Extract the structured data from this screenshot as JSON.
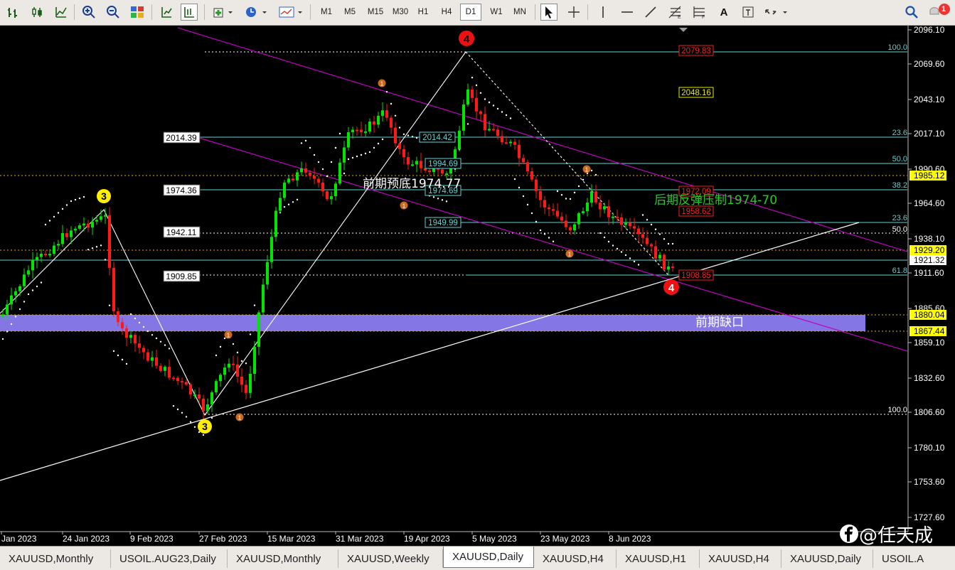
{
  "toolbar": {
    "timeframes": [
      "M1",
      "M5",
      "M15",
      "M30",
      "H1",
      "H4",
      "D1",
      "W1",
      "MN"
    ],
    "active_timeframe": "D1",
    "icons": [
      "bar-chart-icon",
      "candlestick-icon",
      "line-chart-icon",
      "zoom-in-icon",
      "zoom-out-icon",
      "tile-windows-icon",
      "chart-shift-icon",
      "autoscroll-icon",
      "indicators-icon",
      "periods-icon",
      "templates-icon",
      "cursor-icon",
      "crosshair-icon",
      "vertical-line-icon",
      "horizontal-line-icon",
      "trendline-icon",
      "fibonacci-icon",
      "fibonacci-fan-icon",
      "text-icon",
      "label-icon",
      "arrows-icon",
      "search-icon",
      "notifications-icon"
    ],
    "notification_count": "1"
  },
  "chart": {
    "symbol": "XAUUSD",
    "timeframe": "Daily",
    "price_axis_labels": [
      "2096.10",
      "2069.60",
      "2043.10",
      "2017.10",
      "1990.60",
      "1964.60",
      "1938.10",
      "1911.60",
      "1885.60",
      "1859.10",
      "1832.60",
      "1806.60",
      "1780.10",
      "1753.60",
      "1727.60"
    ],
    "highlighted_prices": [
      {
        "text": "1985.12",
        "bg": "#ffff00",
        "fg": "#000000"
      },
      {
        "text": "1929.20",
        "bg": "#ffff00",
        "fg": "#000000"
      },
      {
        "text": "1921.32",
        "bg": "#ffffff",
        "fg": "#000000"
      },
      {
        "text": "1880.04",
        "bg": "#ffff00",
        "fg": "#000000"
      },
      {
        "text": "1867.44",
        "bg": "#ffff00",
        "fg": "#000000"
      }
    ],
    "date_labels": [
      "Jan 2023",
      "24 Jan 2023",
      "9 Feb 2023",
      "27 Feb 2023",
      "15 Mar 2023",
      "31 Mar 2023",
      "19 Apr 2023",
      "5 May 2023",
      "23 May 2023",
      "8 Jun 2023"
    ],
    "level_boxes_white": [
      "2014.39",
      "1974.36",
      "1942.11",
      "1909.85"
    ],
    "level_boxes_cyan": [
      "2014.42",
      "1994.69",
      "1974.69",
      "1949.99"
    ],
    "level_boxes_red": [
      "2079.83",
      "1972.09",
      "1958.62",
      "1908.85"
    ],
    "level_box_yellow": "2048.16",
    "fib_right_labels": [
      "100.0",
      "23.6",
      "50.0",
      "38.2",
      "23.6",
      "50.0",
      "61.8",
      "100.0"
    ],
    "annotations": {
      "prev_high": "前期预底1974.77",
      "resistance": "后期反弹压制1974-70",
      "gap": "前期缺口"
    },
    "wave_labels": {
      "yellow": "3",
      "red": "4",
      "orange": "1"
    },
    "colors": {
      "bull": "#00e600",
      "bear": "#ff1a1a",
      "channel": "#c000c0",
      "gap_zone": "#8b7cf0",
      "fib": "#5fd3d3",
      "background": "#000000"
    }
  },
  "tabs": [
    "XAUUSD,Monthly",
    "USOIL.AUG23,Daily",
    "XAUUSD,Monthly",
    "XAUUSD,Weekly",
    "XAUUSD,Daily",
    "XAUUSD,H4",
    "XAUUSD,H1",
    "XAUUSD,H4",
    "XAUUSD,Daily",
    "USOIL.A"
  ],
  "active_tab": "XAUUSD,Daily",
  "watermark": "@任天成"
}
